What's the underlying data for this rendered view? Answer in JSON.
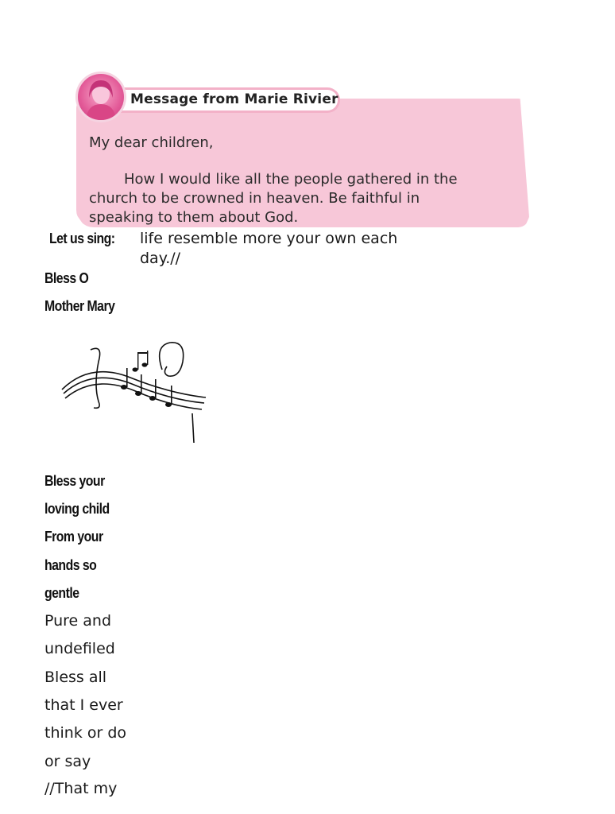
{
  "message": {
    "title": "Message from Marie Rivier",
    "salutation": "My dear children,",
    "body": "How I would like all the people gathered in the church to be crowned in heaven. Be faithful in speaking to them about God."
  },
  "song": {
    "heading": "Let us sing:",
    "continuation": "life resemble more your own each day.//",
    "bold_lines": [
      "Bless O",
      "Mother Mary",
      "Bless your",
      "loving child",
      "From your",
      "hands so",
      "gentle"
    ],
    "normal_lines": [
      "Pure and",
      "undefiled",
      "Bless all",
      "that I ever",
      "think or do",
      "or say",
      "//That my"
    ]
  },
  "colors": {
    "message_bg": "#f7c7d8",
    "accent": "#e35a98"
  }
}
